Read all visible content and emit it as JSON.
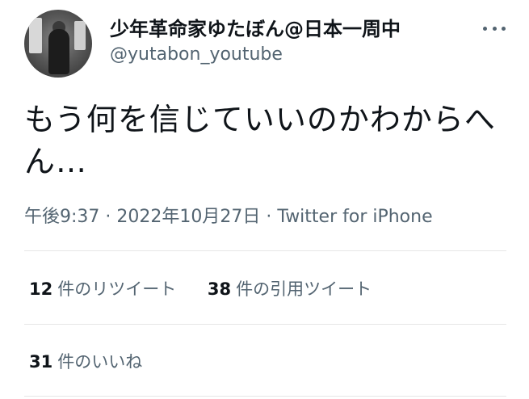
{
  "header": {
    "display_name": "少年革命家ゆたぼん@日本一周中",
    "handle": "@yutabon_youtube",
    "more_icon": "more-horizontal-icon"
  },
  "tweet": {
    "text": "もう何を信じていいのかわからへん…",
    "time": "午後9:37",
    "date": "2022年10月27日",
    "separator": "·",
    "source": "Twitter for iPhone"
  },
  "stats": {
    "retweets": {
      "count": "12",
      "label": "件のリツイート"
    },
    "quotes": {
      "count": "38",
      "label": "件の引用ツイート"
    },
    "likes": {
      "count": "31",
      "label": "件のいいね"
    }
  }
}
